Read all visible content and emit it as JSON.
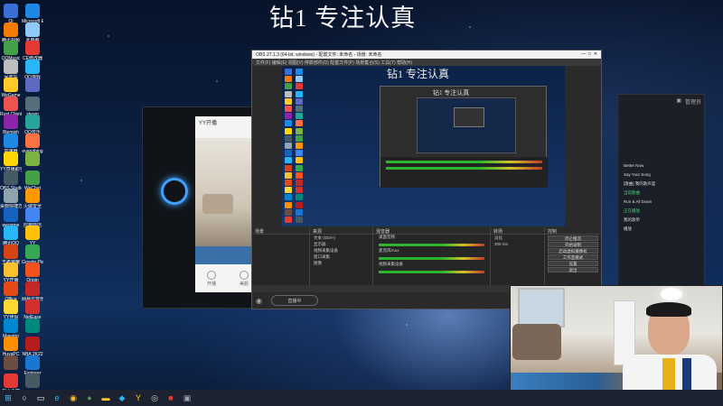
{
  "headline": "钻1 专注认真",
  "desktop_icons": [
    {
      "label": "Qi",
      "color": "#3b6fd6"
    },
    {
      "label": "Microsoft Edge",
      "color": "#1e88e5"
    },
    {
      "label": "腾讯视频",
      "color": "#f57c00"
    },
    {
      "label": "此电脑",
      "color": "#90caf9"
    },
    {
      "label": "QQMusic",
      "color": "#43a047"
    },
    {
      "label": "CE修改器",
      "color": "#e53935"
    },
    {
      "label": "回收站",
      "color": "#bdbdbd"
    },
    {
      "label": "QQ游戏",
      "color": "#29b6f6"
    },
    {
      "label": "WeGame",
      "color": "#ffca28"
    },
    {
      "label": "",
      "color": "#5c6bc0"
    },
    {
      "label": "Rust Client",
      "color": "#ef5350"
    },
    {
      "label": "steam",
      "color": "#546e7a"
    },
    {
      "label": "Blemish",
      "color": "#8e24aa"
    },
    {
      "label": "QQ音乐",
      "color": "#26a69a"
    },
    {
      "label": "加速器",
      "color": "#1e88e5"
    },
    {
      "label": "everything",
      "color": "#ff7043"
    },
    {
      "label": "YY直播助手",
      "color": "#ffd600"
    },
    {
      "label": "",
      "color": "#7cb342"
    },
    {
      "label": "OBS Studio",
      "color": "#455a64"
    },
    {
      "label": "WeChat",
      "color": "#43a047"
    },
    {
      "label": "桌面快捷方式",
      "color": "#90a4ae"
    },
    {
      "label": "火绒安全",
      "color": "#ff9800"
    },
    {
      "label": "wegame",
      "color": "#1565c0"
    },
    {
      "label": "应用商店",
      "color": "#4285f4"
    },
    {
      "label": "腾讯QQ",
      "color": "#29b6f6"
    },
    {
      "label": "YY",
      "color": "#ffc107"
    },
    {
      "label": "王者荣耀",
      "color": "#d84315"
    },
    {
      "label": "Google Play",
      "color": "#34a853"
    },
    {
      "label": "YY开播",
      "color": "#fbc02d"
    },
    {
      "label": "Origin",
      "color": "#f4511e"
    },
    {
      "label": "Office",
      "color": "#e64a19"
    },
    {
      "label": "网易云音乐",
      "color": "#c62828"
    },
    {
      "label": "YY伴侣",
      "color": "#fdd835"
    },
    {
      "label": "NetEase",
      "color": "#d32f2f"
    },
    {
      "label": "Maestro",
      "color": "#0288d1"
    },
    {
      "label": "",
      "color": "#00897b"
    },
    {
      "label": "HuyaPC",
      "color": "#ff8f00"
    },
    {
      "label": "NBA 2K22",
      "color": "#b71c1c"
    },
    {
      "label": "",
      "color": "#6d4c41"
    },
    {
      "label": "Explorer",
      "color": "#1976d2"
    },
    {
      "label": "金山毒霸",
      "color": "#e53935"
    },
    {
      "label": "",
      "color": "#455a64"
    }
  ],
  "taskbar": {
    "buttons": [
      {
        "icon": "windows-icon",
        "glyph": "⊞",
        "color": "#4fc3f7"
      },
      {
        "icon": "search-icon",
        "glyph": "○",
        "color": "#ffffff"
      },
      {
        "icon": "task-view-icon",
        "glyph": "▭",
        "color": "#ffffff"
      },
      {
        "icon": "edge-icon",
        "glyph": "e",
        "color": "#29b6f6"
      },
      {
        "icon": "chrome-icon",
        "glyph": "◉",
        "color": "#fbc02d"
      },
      {
        "icon": "wechat-icon",
        "glyph": "●",
        "color": "#43a047"
      },
      {
        "icon": "folder-icon",
        "glyph": "▬",
        "color": "#ffca28"
      },
      {
        "icon": "qq-icon",
        "glyph": "◆",
        "color": "#29b6f6"
      },
      {
        "icon": "yy-icon",
        "glyph": "Y",
        "color": "#ffd600"
      },
      {
        "icon": "obs-icon",
        "glyph": "◎",
        "color": "#cccccc"
      },
      {
        "icon": "game-icon",
        "glyph": "■",
        "color": "#e53935"
      },
      {
        "icon": "camera-icon",
        "glyph": "▣",
        "color": "#90a4ae"
      }
    ]
  },
  "yy": {
    "title": "YY开播",
    "actions": [
      "开播",
      "美颜"
    ]
  },
  "obs": {
    "title": "OBS 27.1.3 (64-bit, windows) - 配置文件: 未命名 - 场景: 未命名",
    "menu": "文件(F)  编辑(E)  视图(V)  停靠部件(D)  配置文件(P)  场景集合(S)  工具(T)  帮助(H)",
    "preview_title": "钻1 专注认真",
    "nested_title": "钻1 专注认真",
    "dock": {
      "scenes_header": "场景",
      "sources_header": "来源",
      "mixer_header": "混音器",
      "transitions_header": "转场",
      "controls_header": "控制",
      "sources": [
        "文本 (GDI+)",
        "显示器",
        "视频采集设备",
        "窗口采集",
        "图像"
      ],
      "mixer_channels": [
        "桌面音频",
        "麦克风/Aux",
        "视频采集设备"
      ],
      "transition": "淡化",
      "duration": "300 ms",
      "controls": [
        "停止推流",
        "开始录制",
        "启动虚拟摄像机",
        "工作室模式",
        "设置",
        "退出"
      ]
    },
    "status": {
      "live_button": "直播中"
    }
  },
  "chat": {
    "header_label": "管理员",
    "items": [
      {
        "text": "Better Now",
        "green": false
      },
      {
        "text": "Say Your Song",
        "green": false
      },
      {
        "text": "[歌曲] 我的歌声里",
        "green": false
      },
      {
        "text": "当前歌曲",
        "green": true
      },
      {
        "text": "Run & All Down",
        "green": false
      },
      {
        "text": "正在播放",
        "green": true
      },
      {
        "text": "我的歌单",
        "green": false
      },
      {
        "text": "播放",
        "green": false
      }
    ]
  }
}
